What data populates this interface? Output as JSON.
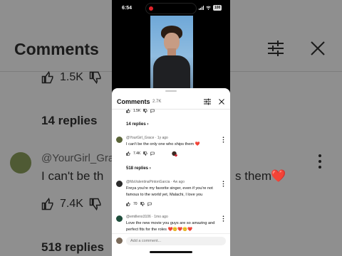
{
  "background": {
    "title": "Comments",
    "likes": "1.5K",
    "replies_1": "14 replies",
    "username": "@YourGirl_Gra",
    "comment_left": "I can't be th",
    "comment_right": "s them",
    "heart": "❤️",
    "likes_2": "7.4K",
    "replies_2": "518 replies"
  },
  "status_bar": {
    "time": "6:54",
    "battery": "100"
  },
  "sheet": {
    "title": "Comments",
    "count": "2.7K",
    "top_likes": "1.5K",
    "top_replies": "14 replies",
    "comments": [
      {
        "user": "@YourGirl_Grace · 1y ago",
        "text": "I can't be the only one who ships them ❤️",
        "likes": "7.4K",
        "replies": "518 replies",
        "avatar_color": "#5a6438"
      },
      {
        "user": "@MaValentinaPintonGarcia · 4w ago",
        "text": "Freya you're my favorite singer, even if you're not famous to the world yet, Malachi, I love you",
        "likes": "70",
        "avatar_color": "#2b2b2b"
      },
      {
        "user": "@emilleno3106 · 1mo ago",
        "text": "Love the new movie you guys are so amazing and perfect fits for the roles ❤️😊❤️😊❤️",
        "avatar_color": "#1e4d3a"
      }
    ],
    "add_comment_placeholder": "Add a comment..."
  },
  "colors": {
    "heart": "#d01f2e",
    "sheet_bg": "#ffffff",
    "dim_bg": "#8f8f8f"
  }
}
